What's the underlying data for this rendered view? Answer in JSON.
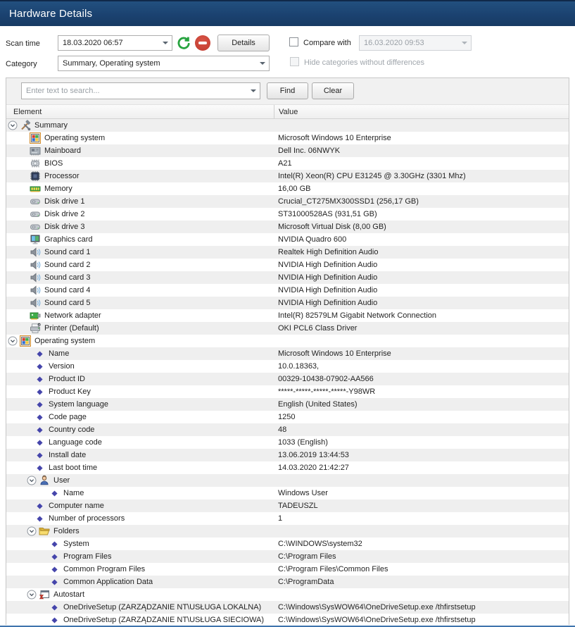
{
  "window": {
    "title": "Hardware Details"
  },
  "toolbar": {
    "scan_time_label": "Scan time",
    "scan_time_value": "18.03.2020 06:57",
    "details_button": "Details",
    "compare_with_label": "Compare with",
    "compare_value": "16.03.2020 09:53",
    "category_label": "Category",
    "category_value": "Summary, Operating system",
    "hide_categories_label": "Hide categories without differences"
  },
  "search": {
    "placeholder": "Enter text to search...",
    "find_button": "Find",
    "clear_button": "Clear"
  },
  "colors": {
    "titlebar": "#1b4270",
    "row_alternate": "#efefef",
    "refresh_green": "#27a33f",
    "stop_red": "#c03a2e",
    "diamond_blue": "#4545ab",
    "bottom_border_blue": "#3f74ad"
  },
  "table": {
    "columns": [
      "Element",
      "Value"
    ],
    "rows": [
      {
        "kind": "group",
        "level": 0,
        "icon": "tools",
        "label": "Summary",
        "value": ""
      },
      {
        "kind": "item",
        "level": 1,
        "icon": "windows",
        "label": "Operating system",
        "value": "Microsoft Windows 10 Enterprise"
      },
      {
        "kind": "item",
        "level": 1,
        "icon": "mainboard",
        "label": "Mainboard",
        "value": "Dell Inc. 06NWYK"
      },
      {
        "kind": "item",
        "level": 1,
        "icon": "bios",
        "label": "BIOS",
        "value": "A21"
      },
      {
        "kind": "item",
        "level": 1,
        "icon": "processor",
        "label": "Processor",
        "value": "Intel(R) Xeon(R) CPU E31245 @ 3.30GHz (3301 Mhz)"
      },
      {
        "kind": "item",
        "level": 1,
        "icon": "memory",
        "label": "Memory",
        "value": "16,00 GB"
      },
      {
        "kind": "item",
        "level": 1,
        "icon": "disk",
        "label": "Disk drive 1",
        "value": "Crucial_CT275MX300SSD1 (256,17 GB)"
      },
      {
        "kind": "item",
        "level": 1,
        "icon": "disk",
        "label": "Disk drive 2",
        "value": "ST31000528AS (931,51 GB)"
      },
      {
        "kind": "item",
        "level": 1,
        "icon": "disk",
        "label": "Disk drive 3",
        "value": "Microsoft Virtual Disk (8,00 GB)"
      },
      {
        "kind": "item",
        "level": 1,
        "icon": "graphics",
        "label": "Graphics card",
        "value": "NVIDIA Quadro 600"
      },
      {
        "kind": "item",
        "level": 1,
        "icon": "sound",
        "label": "Sound card 1",
        "value": "Realtek High Definition Audio"
      },
      {
        "kind": "item",
        "level": 1,
        "icon": "sound",
        "label": "Sound card 2",
        "value": "NVIDIA High Definition Audio"
      },
      {
        "kind": "item",
        "level": 1,
        "icon": "sound",
        "label": "Sound card 3",
        "value": "NVIDIA High Definition Audio"
      },
      {
        "kind": "item",
        "level": 1,
        "icon": "sound",
        "label": "Sound card 4",
        "value": "NVIDIA High Definition Audio"
      },
      {
        "kind": "item",
        "level": 1,
        "icon": "sound",
        "label": "Sound card 5",
        "value": "NVIDIA High Definition Audio"
      },
      {
        "kind": "item",
        "level": 1,
        "icon": "network",
        "label": "Network adapter",
        "value": "Intel(R) 82579LM Gigabit Network Connection"
      },
      {
        "kind": "item",
        "level": 1,
        "icon": "printer",
        "label": "Printer (Default)",
        "value": "OKI PCL6 Class Driver"
      },
      {
        "kind": "group",
        "level": 0,
        "icon": "windows",
        "label": "Operating system",
        "value": ""
      },
      {
        "kind": "item",
        "level": 1,
        "icon": "diamond",
        "label": "Name",
        "value": "Microsoft Windows 10 Enterprise"
      },
      {
        "kind": "item",
        "level": 1,
        "icon": "diamond",
        "label": "Version",
        "value": "10.0.18363,"
      },
      {
        "kind": "item",
        "level": 1,
        "icon": "diamond",
        "label": "Product ID",
        "value": "00329-10438-07902-AA566"
      },
      {
        "kind": "item",
        "level": 1,
        "icon": "diamond",
        "label": "Product Key",
        "value": "*****-*****-*****-*****-Y98WR"
      },
      {
        "kind": "item",
        "level": 1,
        "icon": "diamond",
        "label": "System language",
        "value": "English (United States)"
      },
      {
        "kind": "item",
        "level": 1,
        "icon": "diamond",
        "label": "Code page",
        "value": "1250"
      },
      {
        "kind": "item",
        "level": 1,
        "icon": "diamond",
        "label": "Country code",
        "value": "48"
      },
      {
        "kind": "item",
        "level": 1,
        "icon": "diamond",
        "label": "Language code",
        "value": "1033 (English)"
      },
      {
        "kind": "item",
        "level": 1,
        "icon": "diamond",
        "label": "Install date",
        "value": "13.06.2019 13:44:53"
      },
      {
        "kind": "item",
        "level": 1,
        "icon": "diamond",
        "label": "Last boot time",
        "value": "14.03.2020 21:42:27"
      },
      {
        "kind": "group",
        "level": 1,
        "icon": "user",
        "label": "User",
        "value": ""
      },
      {
        "kind": "item",
        "level": 2,
        "icon": "diamond",
        "label": "Name",
        "value": "Windows User"
      },
      {
        "kind": "item",
        "level": 1,
        "icon": "diamond",
        "label": "Computer name",
        "value": "TADEUSZL"
      },
      {
        "kind": "item",
        "level": 1,
        "icon": "diamond",
        "label": "Number of processors",
        "value": "1"
      },
      {
        "kind": "group",
        "level": 1,
        "icon": "folder",
        "label": "Folders",
        "value": ""
      },
      {
        "kind": "item",
        "level": 2,
        "icon": "diamond",
        "label": "System",
        "value": "C:\\WINDOWS\\system32"
      },
      {
        "kind": "item",
        "level": 2,
        "icon": "diamond",
        "label": "Program Files",
        "value": "C:\\Program Files"
      },
      {
        "kind": "item",
        "level": 2,
        "icon": "diamond",
        "label": "Common Program Files",
        "value": "C:\\Program Files\\Common Files"
      },
      {
        "kind": "item",
        "level": 2,
        "icon": "diamond",
        "label": "Common Application Data",
        "value": "C:\\ProgramData"
      },
      {
        "kind": "group",
        "level": 1,
        "icon": "autostart",
        "label": "Autostart",
        "value": ""
      },
      {
        "kind": "item",
        "level": 2,
        "icon": "diamond",
        "label": "OneDriveSetup (ZARZĄDZANIE NT\\USŁUGA LOKALNA)",
        "value": "C:\\Windows\\SysWOW64\\OneDriveSetup.exe /thfirstsetup"
      },
      {
        "kind": "item",
        "level": 2,
        "icon": "diamond",
        "label": "OneDriveSetup (ZARZĄDZANIE NT\\USŁUGA SIECIOWA)",
        "value": "C:\\Windows\\SysWOW64\\OneDriveSetup.exe /thfirstsetup"
      }
    ]
  }
}
